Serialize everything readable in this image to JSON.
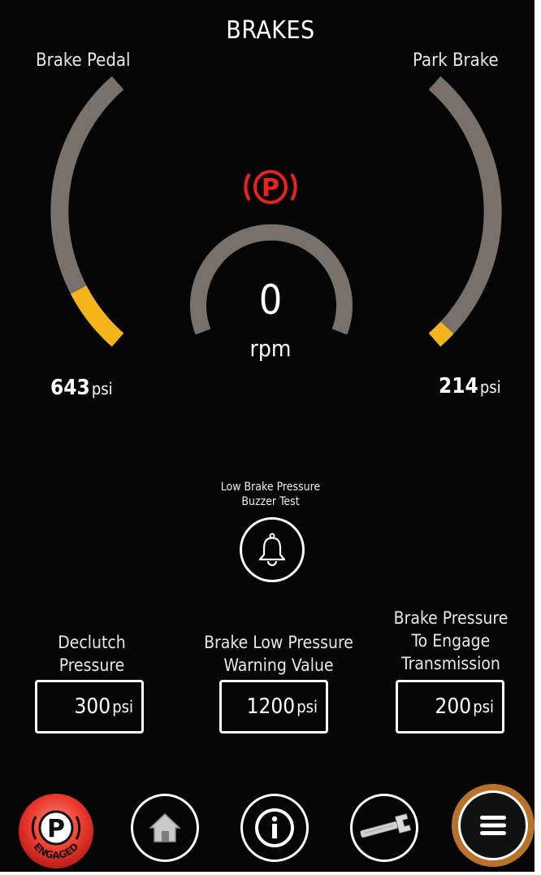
{
  "header": {
    "title": "BRAKES"
  },
  "gauges": {
    "brake_pedal": {
      "label": "Brake Pedal",
      "value": "643",
      "unit": "psi",
      "fill_fraction": 0.22
    },
    "park_brake": {
      "label": "Park Brake",
      "value": "214",
      "unit": "psi",
      "fill_fraction": 0.06
    },
    "engine": {
      "value": "0",
      "unit": "rpm",
      "fill_fraction": 0
    }
  },
  "park_indicator": {
    "symbol": "P",
    "icon": "parking-brake-warning-icon",
    "color": "#e8231a"
  },
  "buzzer": {
    "label_line1": "Low Brake Pressure",
    "label_line2": "Buzzer Test",
    "icon": "bell-icon"
  },
  "settings": [
    {
      "label_lines": [
        "Declutch",
        "Pressure"
      ],
      "value": "300",
      "unit": "psi"
    },
    {
      "label_lines": [
        "Brake Low Pressure",
        "Warning Value"
      ],
      "value": "1200",
      "unit": "psi"
    },
    {
      "label_lines": [
        "Brake Pressure",
        "To Engage",
        "Transmission"
      ],
      "value": "200",
      "unit": "psi"
    }
  ],
  "nav": {
    "park_button": {
      "symbol": "P",
      "status": "ENGAGED"
    },
    "home_icon": "home-icon",
    "info_icon": "info-icon",
    "tools_icon": "wrench-icon",
    "menu_icon": "menu-icon"
  },
  "colors": {
    "accent": "#f4b41a",
    "gauge_track": "#78706a",
    "alert_red": "#e8231a",
    "menu_ring": "#b8722a"
  }
}
